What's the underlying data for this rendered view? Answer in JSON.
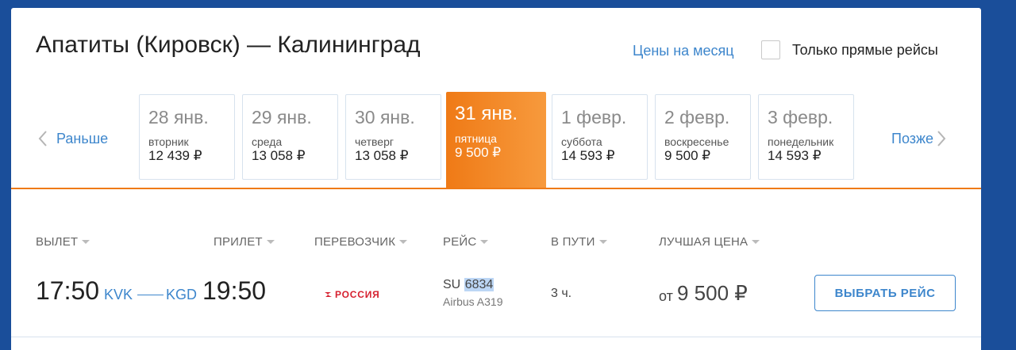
{
  "header": {
    "route_title": "Апатиты (Кировск) — Калининград",
    "month_prices_link": "Цены на месяц",
    "direct_only_label": "Только прямые рейсы",
    "direct_only_checked": false
  },
  "date_nav": {
    "earlier_label": "Раньше",
    "later_label": "Позже",
    "dates": [
      {
        "date": "28 янв.",
        "weekday": "вторник",
        "price": "12 439 ₽",
        "active": false
      },
      {
        "date": "29 янв.",
        "weekday": "среда",
        "price": "13 058 ₽",
        "active": false
      },
      {
        "date": "30 янв.",
        "weekday": "четверг",
        "price": "13 058 ₽",
        "active": false
      },
      {
        "date": "31 янв.",
        "weekday": "пятница",
        "price": "9 500 ₽",
        "active": true
      },
      {
        "date": "1 февр.",
        "weekday": "суббота",
        "price": "14 593 ₽",
        "active": false
      },
      {
        "date": "2 февр.",
        "weekday": "воскресенье",
        "price": "9 500 ₽",
        "active": false
      },
      {
        "date": "3 февр.",
        "weekday": "понедельник",
        "price": "14 593 ₽",
        "active": false
      }
    ]
  },
  "columns": {
    "departure": "ВЫЛЕТ",
    "arrival": "ПРИЛЕТ",
    "carrier": "ПЕРЕВОЗЧИК",
    "flight": "РЕЙС",
    "duration": "В ПУТИ",
    "best_price": "ЛУЧШАЯ ЦЕНА"
  },
  "flight": {
    "dep_time": "17:50",
    "dep_airport": "KVK",
    "arr_airport": "KGD",
    "arr_time": "19:50",
    "carrier_name": "РОССИЯ",
    "flight_prefix": "SU",
    "flight_number": "6834",
    "aircraft": "Airbus A319",
    "duration": "3 ч.",
    "price_prefix": "от",
    "price": "9 500 ₽",
    "select_label": "ВЫБРАТЬ РЕЙС"
  },
  "colors": {
    "accent_blue": "#3d86cc",
    "accent_orange": "#ef7a16",
    "page_background": "#1a4e9a",
    "carrier_red": "#d6202f"
  }
}
